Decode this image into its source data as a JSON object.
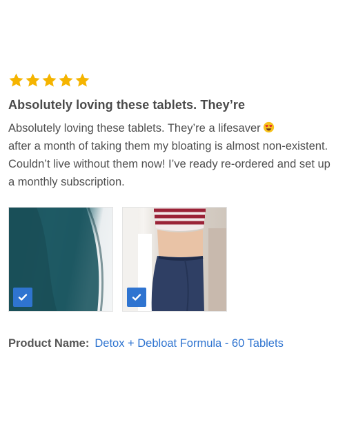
{
  "review": {
    "rating": 5,
    "max_rating": 5,
    "title": "Absolutely loving these tablets. They’re",
    "body": "Absolutely loving these tablets. They’re a lifesaver",
    "body_rest": "after a month of taking them my bloating is almost non-existent. Couldn’t live without them now! I’ve ready re-ordered and set up a monthly subscription.",
    "emoji": "heart-eyes-emoji",
    "photos": [
      {
        "selected": true
      },
      {
        "selected": true
      }
    ]
  },
  "product": {
    "label": "Product Name:",
    "name": "Detox + Debloat Formula - 60 Tablets"
  },
  "colors": {
    "star": "#f5b400",
    "link": "#2f74d0",
    "checkbox": "#2f74d0",
    "text": "#4a4a4a"
  }
}
